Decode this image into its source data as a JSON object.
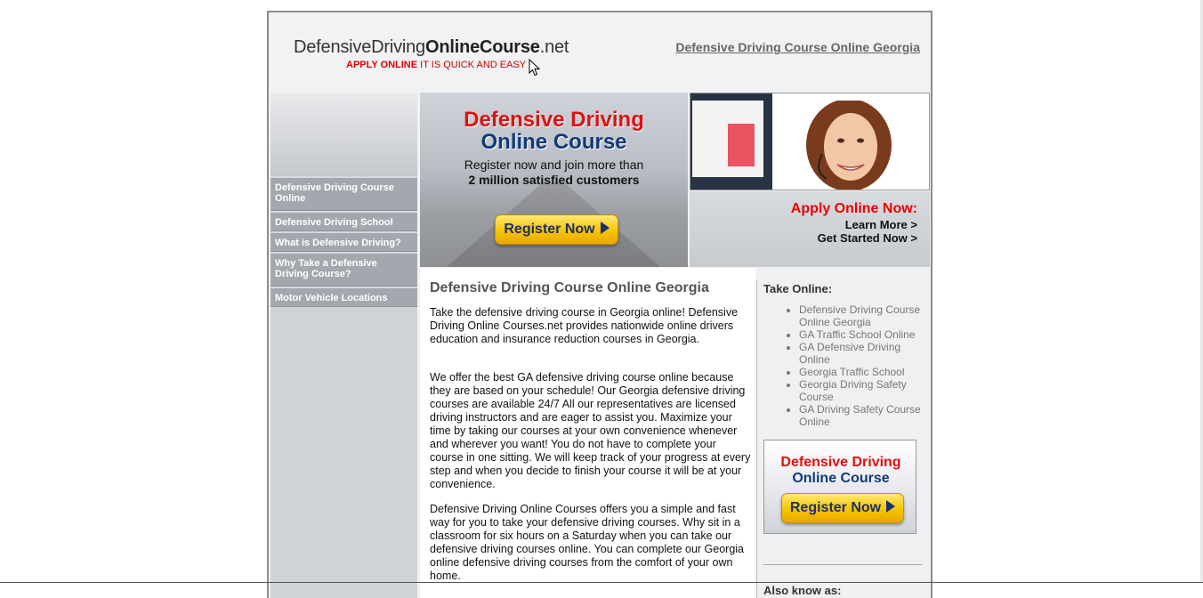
{
  "header": {
    "logo_main_prefix": "DefensiveDriving",
    "logo_main_bold": "OnlineCourse",
    "logo_main_suffix": ".net",
    "tagline_red": "APPLY ONLINE",
    "tagline_rest": "IT IS QUICK AND EASY",
    "top_link": "Defensive Driving Course Online Georgia"
  },
  "sidebar": {
    "items": [
      {
        "label": "Defensive Driving Course Online"
      },
      {
        "label": "Defensive Driving School"
      },
      {
        "label": "What is Defensive Driving?"
      },
      {
        "label": "Why Take a Defensive Driving Course?"
      },
      {
        "label": "Motor Vehicle Locations"
      }
    ]
  },
  "banner": {
    "title_red": "Defensive Driving",
    "title_blue": "Online Course",
    "sub1": "Register now and join more than",
    "sub2": "2 million satisfied customers",
    "button": "Register Now"
  },
  "apply": {
    "title": "Apply Online Now:",
    "learn_more": "Learn More >",
    "get_started": "Get Started Now >"
  },
  "content": {
    "title": "Defensive Driving Course Online Georgia",
    "p1": "Take the defensive driving course in Georgia online! Defensive Driving Online Courses.net provides nationwide online drivers education and insurance reduction courses in Georgia.",
    "p2": "We offer the best GA defensive driving course online because they are based on your schedule! Our Georgia defensive driving courses are available 24/7 All our representatives are licensed driving instructors and are eager to assist you. Maximize your time by taking our courses at your own convenience whenever and wherever you want! You do not have to complete your course in one sitting. We will keep track of your progress at every step and when you decide to finish your course it will be at your convenience.",
    "p3": "Defensive Driving Online Courses offers you a simple and fast way for you to take your defensive driving courses. Why sit in a classroom for six hours on a Saturday when you can take our defensive driving courses online. You can complete our Georgia online defensive driving courses from the comfort of your own home."
  },
  "right": {
    "title": "Take Online:",
    "links": [
      "Defensive Driving Course Online Georgia",
      "GA Traffic School Online",
      "GA Defensive Driving Online",
      "Georgia Traffic School",
      "Georgia Driving Safety Course",
      "GA Driving Safety Course Online"
    ],
    "ad_red": "Defensive Driving",
    "ad_blue": "Online Course",
    "ad_button": "Register Now",
    "also_known": "Also know as:"
  }
}
